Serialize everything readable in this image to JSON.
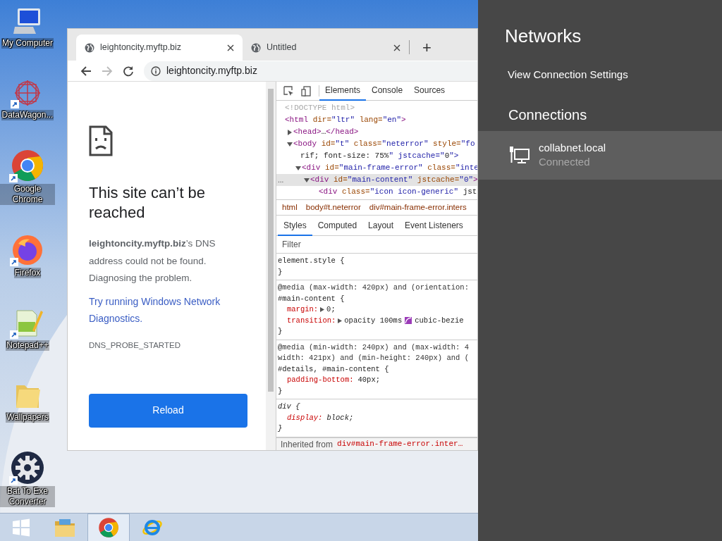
{
  "desktop_icons": [
    {
      "kind": "computer",
      "label": "My Computer",
      "shortcut": false
    },
    {
      "kind": "pattern",
      "label": "DataWagon...",
      "shortcut": true
    },
    {
      "kind": "chrome",
      "label": "Google Chrome",
      "shortcut": true
    },
    {
      "kind": "firefox",
      "label": "Firefox",
      "shortcut": true
    },
    {
      "kind": "notepad",
      "label": "Notepad++",
      "shortcut": true
    },
    {
      "kind": "folder",
      "label": "Wallpapers",
      "shortcut": false
    },
    {
      "kind": "gear",
      "label": "Bat To Exe Converter",
      "shortcut": true
    }
  ],
  "browser": {
    "tabs": [
      {
        "title": "leightoncity.myftp.biz",
        "selected": true
      },
      {
        "title": "Untitled",
        "selected": false
      }
    ],
    "new_tab": "+",
    "address": "leightoncity.myftp.biz",
    "forward_disabled": true,
    "page": {
      "heading": "This site can’t be reached",
      "message": "**leightoncity.myftp.biz**’s DNS address could not be found. Diagnosing the problem.",
      "link": "Try running Windows Network Diagnostics.",
      "error_code": "DNS_PROBE_STARTED",
      "button": "Reload"
    },
    "devtools": {
      "tabs": [
        {
          "label": "Elements",
          "selected": true
        },
        {
          "label": "Console",
          "selected": false
        },
        {
          "label": "Sources",
          "selected": false
        }
      ],
      "dom": [
        {
          "kind": "doctype",
          "lines": [
            "<!DOCTYPE html>"
          ]
        },
        {
          "kind": "element",
          "lines": [
            "<html dir=\"ltr\" lang=\"en\">"
          ],
          "children": [
            {
              "kind": "element",
              "lines": [
                "<head>…</head>"
              ],
              "expanded": false,
              "selected": false
            },
            {
              "kind": "element",
              "lines": [
                "<body id=\"t\" class=\"neterror\" style=\"fo",
                "rif; font-size: 75%\" jstcache=\"0\">"
              ],
              "expanded": true,
              "selected": false,
              "children": [
                {
                  "kind": "element",
                  "lines": [
                    "<div id=\"main-frame-error\" class=\"inte"
                  ],
                  "expanded": true,
                  "selected": false,
                  "children": [
                    {
                      "kind": "element",
                      "lines": [
                        "<div id=\"main-content\" jstcache=\"0\">"
                      ],
                      "expanded": true,
                      "selected": true,
                      "gutter": "...",
                      "children": [
                        {
                          "kind": "element",
                          "lines": [
                            "<div class=\"icon icon-generic\" jst"
                          ]
                        }
                      ]
                    }
                  ]
                }
              ]
            }
          ]
        }
      ],
      "breadcrumbs": [
        "html",
        "body#t.neterror",
        "div#main-frame-error.inters"
      ],
      "style_tabs": [
        {
          "label": "Styles",
          "selected": true
        },
        {
          "label": "Computed",
          "selected": false
        },
        {
          "label": "Layout",
          "selected": false
        },
        {
          "label": "Event Listeners",
          "selected": false
        }
      ],
      "filter_placeholder": "Filter",
      "rules": [
        {
          "selector": "element.style {",
          "close": "}",
          "user_agent": false
        },
        {
          "media": [
            "@media (max-width: 420px) and (orientation:"
          ],
          "selector": "#main-content {",
          "declarations": [
            {
              "property": "margin:",
              "value": "0;",
              "expandable": true
            },
            {
              "property": "transition:",
              "value": "opacity 100ms",
              "expandable": true,
              "easing": "cubic-bezie"
            }
          ],
          "close": "}",
          "user_agent": false
        },
        {
          "media": [
            "@media (min-width: 240px) and (max-width: 4",
            "width: 421px) and (min-height: 240px) and ("
          ],
          "selector": "#details, #main-content {",
          "declarations": [
            {
              "property": "padding-bottom:",
              "value": "40px;",
              "expandable": false
            }
          ],
          "close": "}",
          "user_agent": false
        },
        {
          "selector": "div {",
          "declarations": [
            {
              "property": "display:",
              "value": "block;",
              "expandable": false
            }
          ],
          "close": "}",
          "user_agent": true
        }
      ],
      "inherited_label": "Inherited from",
      "inherited_selector": "div#main-frame-error.inter…"
    }
  },
  "network_panel": {
    "title": "Networks",
    "settings_link": "View Connection Settings",
    "section": "Connections",
    "connections": [
      {
        "name": "collabnet.local",
        "status": "Connected",
        "selected": true
      }
    ]
  },
  "taskbar": [
    {
      "kind": "start",
      "selected": false
    },
    {
      "kind": "explorer",
      "selected": false
    },
    {
      "kind": "chrome",
      "selected": true
    },
    {
      "kind": "ie",
      "selected": false
    }
  ]
}
